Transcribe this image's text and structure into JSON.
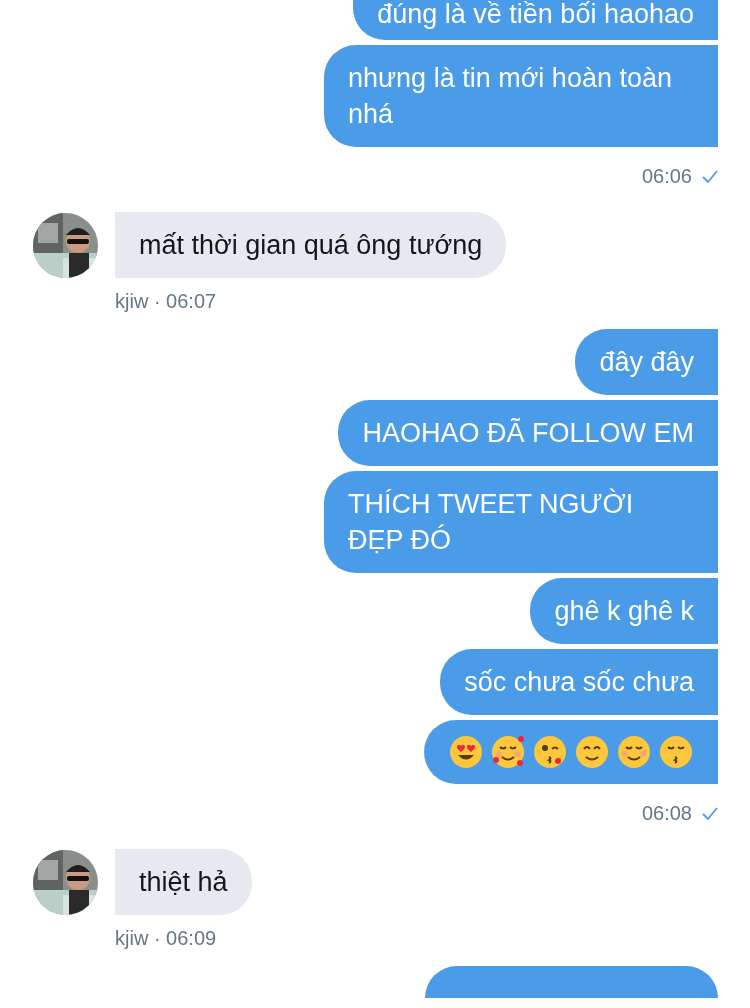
{
  "messages": [
    {
      "kind": "sent",
      "bubbles": [
        {
          "kind": "text",
          "text": "đúng là về tiền bối haohao"
        },
        {
          "kind": "text",
          "text": "nhưng là tin mới hoàn toàn nhá"
        }
      ],
      "time": "06:06",
      "delivered": true
    },
    {
      "kind": "received",
      "sender": "kjiw · 06:07",
      "bubbles": [
        {
          "kind": "text",
          "text": "mất thời gian quá ông tướng"
        }
      ]
    },
    {
      "kind": "sent",
      "bubbles": [
        {
          "kind": "text",
          "text": "đây đây"
        },
        {
          "kind": "text",
          "text": "HAOHAO ĐÃ FOLLOW EM"
        },
        {
          "kind": "text",
          "text": "THÍCH TWEET NGƯỜI ĐẸP ĐÓ"
        },
        {
          "kind": "text",
          "text": "ghê k ghê k"
        },
        {
          "kind": "text",
          "text": "sốc chưa sốc chưa"
        },
        {
          "kind": "emoji",
          "emojis": [
            {
              "kind": "heart-eyes"
            },
            {
              "kind": "hearts"
            },
            {
              "kind": "wink-kiss"
            },
            {
              "kind": "smile"
            },
            {
              "kind": "blush"
            },
            {
              "kind": "kiss"
            }
          ]
        }
      ],
      "time": "06:08",
      "delivered": true
    },
    {
      "kind": "received",
      "sender": "kjiw · 06:09",
      "bubbles": [
        {
          "kind": "text",
          "text": "thiệt hả"
        }
      ]
    },
    {
      "kind": "sent",
      "bubbles": [
        {
          "kind": "partial"
        }
      ]
    }
  ]
}
